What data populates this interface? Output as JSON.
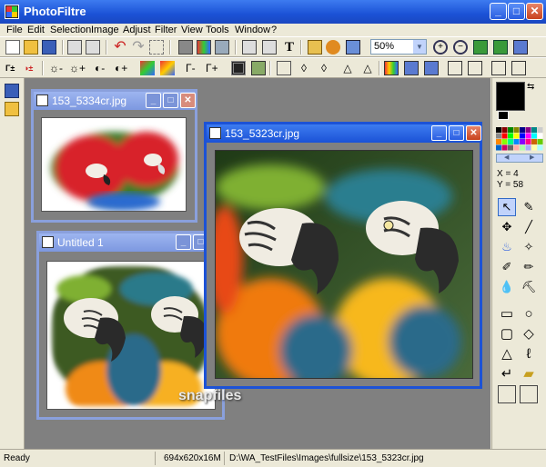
{
  "app": {
    "title": "PhotoFiltre"
  },
  "menu": {
    "file": "File",
    "edit": "Edit",
    "selection": "Selection",
    "image": "Image",
    "adjust": "Adjust",
    "filter": "Filter",
    "view": "View",
    "tools": "Tools",
    "window": "Window",
    "help": "?"
  },
  "toolbar": {
    "zoom_value": "50%"
  },
  "windows": {
    "doc1": {
      "title": "153_5334cr.jpg"
    },
    "doc2": {
      "title": "Untitled 1"
    },
    "doc3": {
      "title": "153_5323cr.jpg"
    }
  },
  "panel": {
    "x_readout": "X = 4",
    "y_readout": "Y = 58",
    "fg_color": "#000000",
    "bg_color": "#ffffff"
  },
  "status": {
    "state": "Ready",
    "dimensions": "694x620x16M",
    "path": "D:\\WA_TestFiles\\Images\\fullsize\\153_5323cr.jpg"
  },
  "watermark": "snapfiles",
  "icons": [
    "new-icon",
    "open-icon",
    "save-icon",
    "print-icon",
    "undo-icon",
    "redo-icon",
    "zoom-in-icon",
    "zoom-out-icon",
    "fit-icon",
    "fullscreen-icon",
    "arrow-tool-icon",
    "eyedropper-icon",
    "line-icon",
    "fill-icon",
    "brush-icon",
    "rect-shape-icon",
    "ellipse-shape-icon"
  ]
}
